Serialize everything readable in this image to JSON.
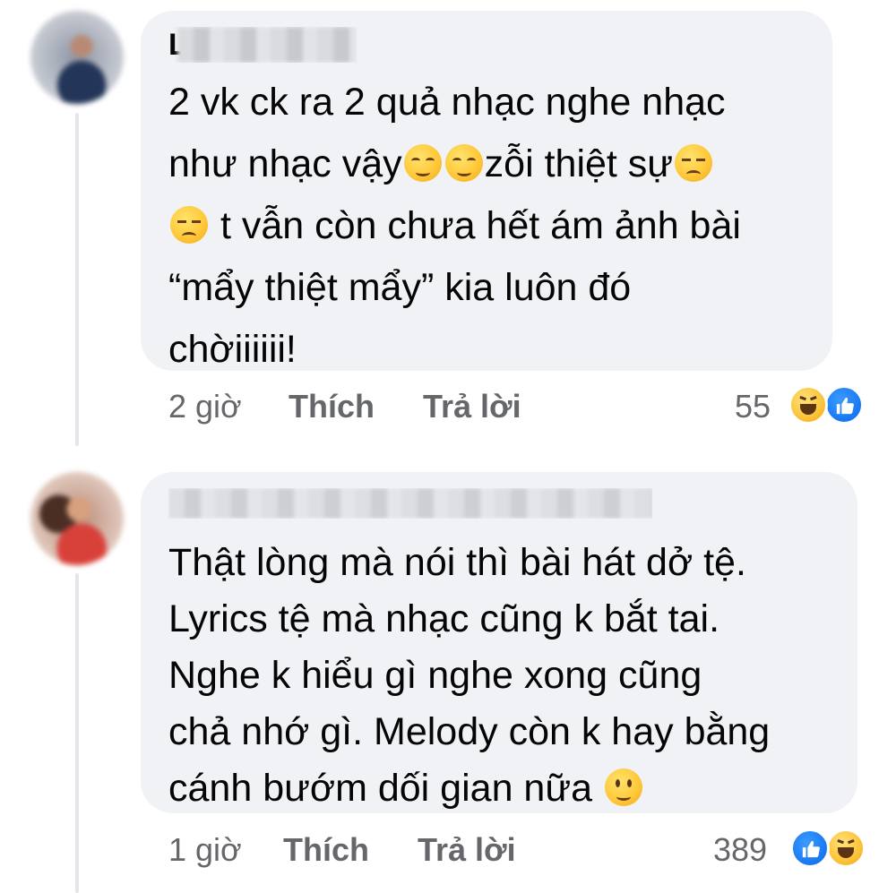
{
  "comments": [
    {
      "author_visible": "L",
      "text_lines": [
        "2 vk ck ra 2 quả nhạc nghe nhạc",
        "như nhạc vậy",
        "zỗi thiệt sự",
        "t vẫn còn chưa hết ám ảnh bài",
        "“mẩy thiệt mẩy” kia luôn đó",
        "chờiiiiii!"
      ],
      "time": "2 giờ",
      "like_label": "Thích",
      "reply_label": "Trả lời",
      "reaction_count": "55",
      "reactions": [
        "haha-icon",
        "like-icon"
      ]
    },
    {
      "author_visible": "",
      "text_lines": [
        "Thật lòng mà nói thì bài hát dở tệ.",
        "Lyrics tệ mà nhạc cũng k bắt tai.",
        "Nghe k hiểu gì nghe xong cũng",
        "chả nhớ gì. Melody còn k hay bằng",
        "cánh bướm dối gian nữa"
      ],
      "time": "1 giờ",
      "like_label": "Thích",
      "reply_label": "Trả lời",
      "reaction_count": "389",
      "reactions": [
        "like-icon",
        "haha-icon"
      ]
    }
  ],
  "colors": {
    "bubble": "#f0f2f5",
    "text": "#050505",
    "meta": "#65676b",
    "like_blue": "#1877f2",
    "haha_yellow": "#fbc338"
  }
}
